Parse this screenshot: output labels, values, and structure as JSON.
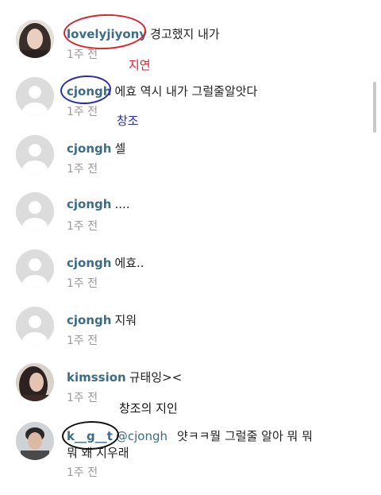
{
  "comments": [
    {
      "username": "lovelyjiyony",
      "text": "경고했지 내가",
      "time": "1주 전"
    },
    {
      "username": "cjongh",
      "text": "에효 역시 내가 그럴줄알앗다",
      "time": "1주 전"
    },
    {
      "username": "cjongh",
      "text": "셀",
      "time": "1주 전"
    },
    {
      "username": "cjongh",
      "text": "....",
      "time": "1주 전"
    },
    {
      "username": "cjongh",
      "text": "에효..",
      "time": "1주 전"
    },
    {
      "username": "cjongh",
      "text": "지워",
      "time": "1주 전"
    },
    {
      "username": "kimssion",
      "text": "규태잉><",
      "time": "1주 전"
    },
    {
      "username": "k__g__t",
      "mention": "@cjongh",
      "text": "얏ㅋㅋ뭘 그럴줄 알아 뭐 뭐",
      "text_cont": "뭐 왜 지우래",
      "time": "1주 전"
    }
  ],
  "annotations": {
    "jiyeon": "지연",
    "changjo": "창조",
    "changjo_friend": "창조의 지인"
  },
  "colors": {
    "username": "#3b6d86",
    "time": "#9a9a9a",
    "annot_red": "#d9232e",
    "annot_blue": "#2a2fa6",
    "annot_black": "#111111"
  }
}
